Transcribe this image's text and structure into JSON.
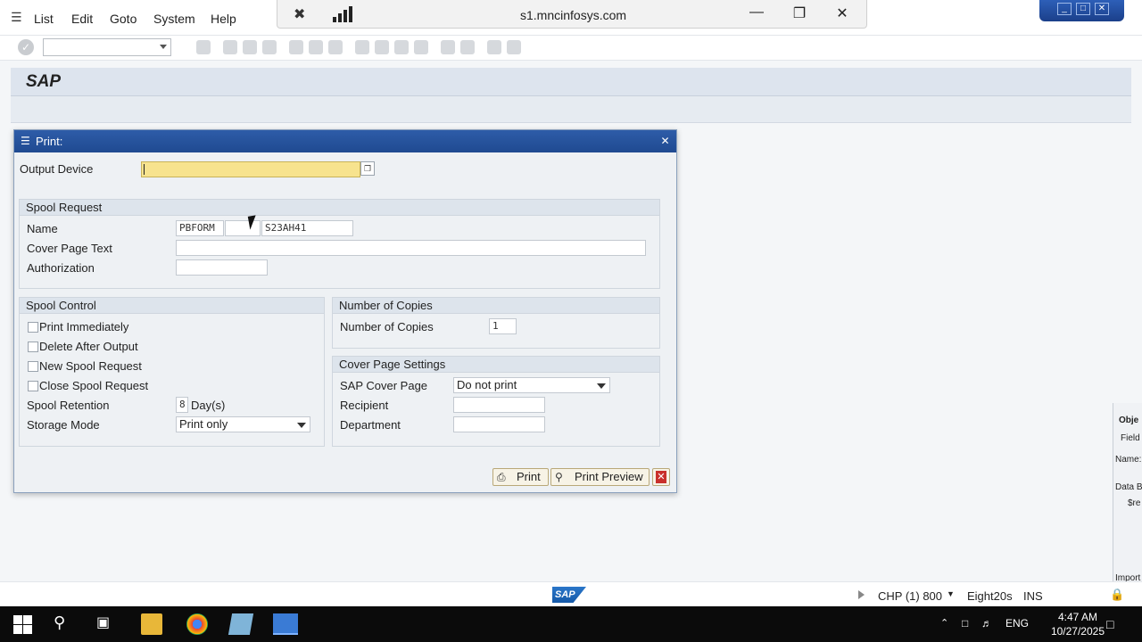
{
  "menu": {
    "items": [
      "List",
      "Edit",
      "Goto",
      "System",
      "Help"
    ]
  },
  "remote": {
    "host": "s1.mncinfosys.com"
  },
  "sap": {
    "title": "SAP"
  },
  "dialog": {
    "title": "Print:",
    "output_device_label": "Output Device",
    "output_device_value": "",
    "spool_request": {
      "header": "Spool Request",
      "name_label": "Name",
      "name_part1": "PBFORM",
      "name_part2": "",
      "name_part3": "S23AH41",
      "cover_text_label": "Cover Page Text",
      "cover_text_value": "",
      "authorization_label": "Authorization",
      "authorization_value": ""
    },
    "spool_control": {
      "header": "Spool Control",
      "print_immediately": "Print Immediately",
      "delete_after_output": "Delete After Output",
      "new_spool_request": "New Spool Request",
      "close_spool_request": "Close Spool Request",
      "retention_label": "Spool Retention",
      "retention_value": "8",
      "retention_unit": "Day(s)",
      "storage_label": "Storage Mode",
      "storage_value": "Print only"
    },
    "copies": {
      "header": "Number of Copies",
      "label": "Number of Copies",
      "value": "1"
    },
    "cover_settings": {
      "header": "Cover Page Settings",
      "sap_cover_label": "SAP Cover Page",
      "sap_cover_value": "Do not print",
      "recipient_label": "Recipient",
      "recipient_value": "",
      "department_label": "Department",
      "department_value": ""
    },
    "buttons": {
      "print": "Print",
      "print_preview": "Print Preview"
    }
  },
  "side_panel": {
    "obj": "Obje",
    "field": "Field",
    "name": "Name:",
    "datab": "Data B",
    "ref": "$re",
    "import": "Import"
  },
  "status": {
    "system": "CHP (1) 800",
    "server": "Eight20s",
    "mode": "INS"
  },
  "taskbar": {
    "lang": "ENG",
    "time": "4:47 AM",
    "date": "10/27/2025"
  }
}
